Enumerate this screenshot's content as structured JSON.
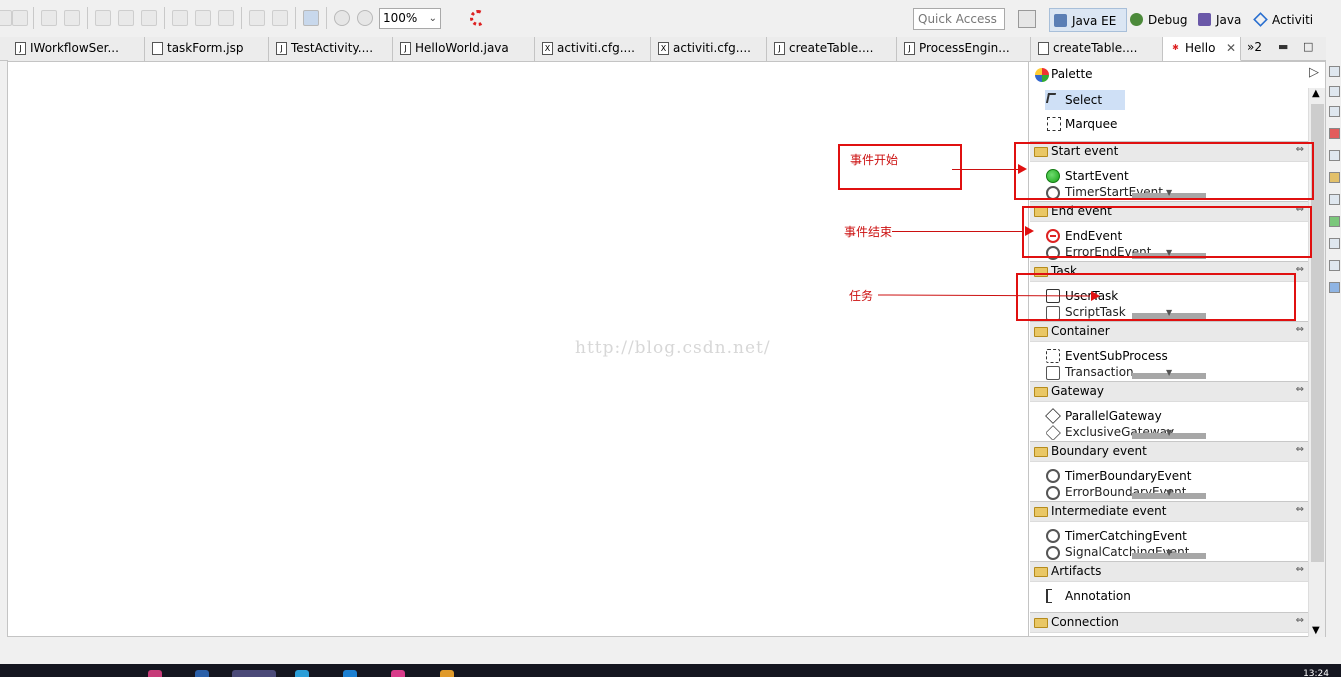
{
  "toolbar": {
    "zoom_value": "100%",
    "quick_access_placeholder": "Quick Access",
    "perspectives": [
      {
        "label": "Java EE",
        "icon": "java-ee-icon",
        "active": true
      },
      {
        "label": "Debug",
        "icon": "debug-icon",
        "active": false
      },
      {
        "label": "Java",
        "icon": "java-icon",
        "active": false
      },
      {
        "label": "Activiti",
        "icon": "activiti-icon",
        "active": false
      }
    ]
  },
  "tabs": [
    {
      "label": "IWorkflowSer...",
      "icon": "java-file-icon"
    },
    {
      "label": "taskForm.jsp",
      "icon": "jsp-file-icon"
    },
    {
      "label": "TestActivity....",
      "icon": "java-file-icon"
    },
    {
      "label": "HelloWorld.java",
      "icon": "java-file-icon"
    },
    {
      "label": "activiti.cfg....",
      "icon": "xml-file-icon"
    },
    {
      "label": "activiti.cfg....",
      "icon": "xml-file-icon"
    },
    {
      "label": "createTable....",
      "icon": "java-file-icon"
    },
    {
      "label": "ProcessEngin...",
      "icon": "java-file-icon"
    },
    {
      "label": "createTable....",
      "icon": "diagram-file-icon"
    },
    {
      "label": "Hello",
      "icon": "bpmn-file-icon",
      "active": true
    }
  ],
  "tabs_overflow": "»2",
  "watermark": "http://blog.csdn.net/",
  "palette": {
    "title": "Palette",
    "tools": [
      {
        "label": "Select",
        "icon": "select-arrow-icon"
      },
      {
        "label": "Marquee",
        "icon": "marquee-icon"
      }
    ],
    "drawers": [
      {
        "label": "Start event",
        "items": [
          "StartEvent",
          "TimerStartEvent"
        ]
      },
      {
        "label": "End event",
        "items": [
          "EndEvent",
          "ErrorEndEvent"
        ]
      },
      {
        "label": "Task",
        "items": [
          "UserTask",
          "ScriptTask"
        ]
      },
      {
        "label": "Container",
        "items": [
          "EventSubProcess",
          "Transaction"
        ]
      },
      {
        "label": "Gateway",
        "items": [
          "ParallelGateway",
          "ExclusiveGateway"
        ]
      },
      {
        "label": "Boundary event",
        "items": [
          "TimerBoundaryEvent",
          "ErrorBoundaryEvent"
        ]
      },
      {
        "label": "Intermediate event",
        "items": [
          "TimerCatchingEvent",
          "SignalCatchingEvent"
        ]
      },
      {
        "label": "Artifacts",
        "items": [
          "Annotation"
        ]
      },
      {
        "label": "Connection",
        "items": []
      }
    ]
  },
  "annotations": [
    {
      "text": "事件开始"
    },
    {
      "text": "事件结束"
    },
    {
      "text": "任务"
    }
  ],
  "taskbar": {
    "clock": "13:24"
  },
  "colors": {
    "annotation_red": "#e01010",
    "selection_blue": "#cfe0f6"
  }
}
